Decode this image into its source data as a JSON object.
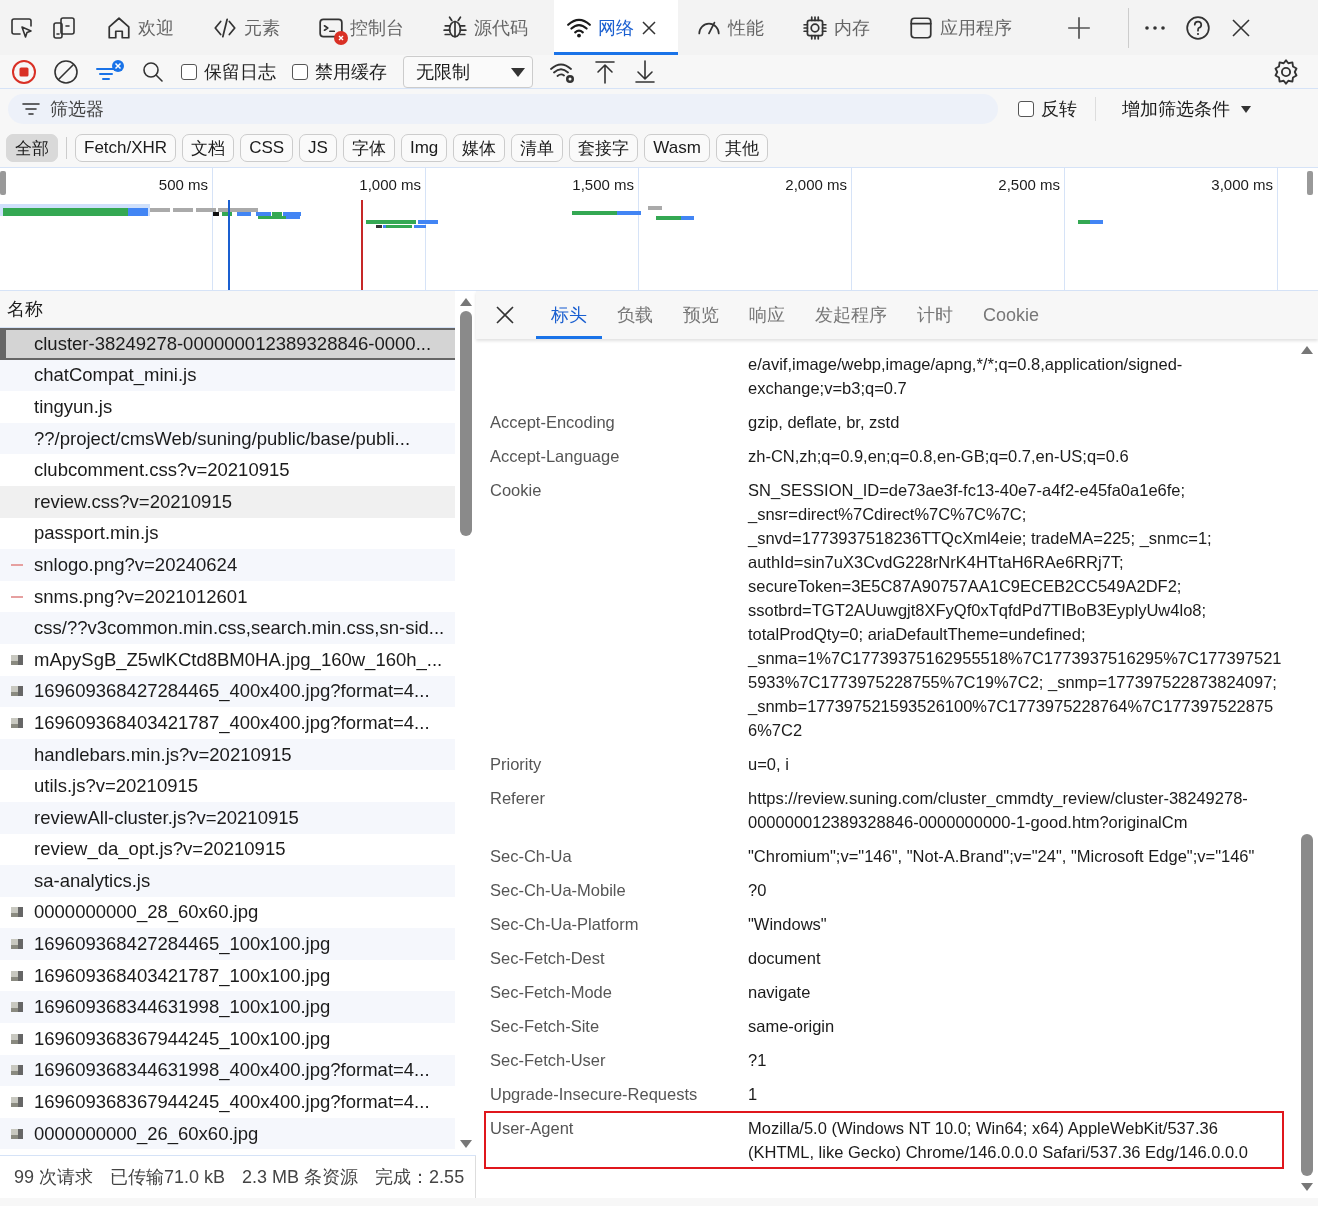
{
  "tabs": [
    {
      "label": "欢迎",
      "selected": false,
      "error_badge": false
    },
    {
      "label": "元素",
      "selected": false,
      "error_badge": false
    },
    {
      "label": "控制台",
      "selected": false,
      "error_badge": true
    },
    {
      "label": "源代码",
      "selected": false,
      "error_badge": false
    },
    {
      "label": "网络",
      "selected": true,
      "error_badge": false
    },
    {
      "label": "性能",
      "selected": false,
      "error_badge": false
    },
    {
      "label": "内存",
      "selected": false,
      "error_badge": false
    },
    {
      "label": "应用程序",
      "selected": false,
      "error_badge": false
    }
  ],
  "toolbar": {
    "recording": true,
    "filter_badge": true,
    "checkboxes": [
      {
        "label": "保留日志",
        "checked": false
      },
      {
        "label": "禁用缓存",
        "checked": false
      }
    ],
    "throttling": {
      "value": "无限制"
    }
  },
  "filter": {
    "placeholder": "筛选器",
    "invert": {
      "label": "反转",
      "checked": false
    },
    "add_filter": "增加筛选条件"
  },
  "type_filters": [
    {
      "label": "全部",
      "selected": true
    },
    {
      "label": "Fetch/XHR",
      "selected": false
    },
    {
      "label": "文档",
      "selected": false
    },
    {
      "label": "CSS",
      "selected": false
    },
    {
      "label": "JS",
      "selected": false
    },
    {
      "label": "字体",
      "selected": false
    },
    {
      "label": "Img",
      "selected": false
    },
    {
      "label": "媒体",
      "selected": false
    },
    {
      "label": "清单",
      "selected": false
    },
    {
      "label": "套接字",
      "selected": false
    },
    {
      "label": "Wasm",
      "selected": false
    },
    {
      "label": "其他",
      "selected": false
    }
  ],
  "timeline": {
    "ticks": [
      "500 ms",
      "1,000 ms",
      "1,500 ms",
      "2,000 ms",
      "2,500 ms",
      "3,000 ms"
    ]
  },
  "requests": {
    "column": "名称",
    "rows": [
      {
        "name": "cluster-38249278-000000012389328846-0000...",
        "kind": "file",
        "selected": true,
        "hovered": false
      },
      {
        "name": "chatCompat_mini.js",
        "kind": "file",
        "selected": false,
        "hovered": false
      },
      {
        "name": "tingyun.js",
        "kind": "file",
        "selected": false,
        "hovered": false
      },
      {
        "name": "??/project/cmsWeb/suning/public/base/publi...",
        "kind": "file",
        "selected": false,
        "hovered": false
      },
      {
        "name": "clubcomment.css?v=20210915",
        "kind": "file",
        "selected": false,
        "hovered": false
      },
      {
        "name": "review.css?v=20210915",
        "kind": "file",
        "selected": false,
        "hovered": true
      },
      {
        "name": "passport.min.js",
        "kind": "file",
        "selected": false,
        "hovered": false
      },
      {
        "name": "snlogo.png?v=20240624",
        "kind": "strip",
        "selected": false,
        "hovered": false
      },
      {
        "name": "snms.png?v=2021012601",
        "kind": "strip",
        "selected": false,
        "hovered": false
      },
      {
        "name": "css/??v3common.min.css,search.min.css,sn-sid...",
        "kind": "file",
        "selected": false,
        "hovered": false
      },
      {
        "name": "mApySgB_Z5wlKCtd8BM0HA.jpg_160w_160h_...",
        "kind": "image",
        "selected": false,
        "hovered": false
      },
      {
        "name": "169609368427284465_400x400.jpg?format=4...",
        "kind": "image",
        "selected": false,
        "hovered": false
      },
      {
        "name": "169609368403421787_400x400.jpg?format=4...",
        "kind": "image",
        "selected": false,
        "hovered": false
      },
      {
        "name": "handlebars.min.js?v=20210915",
        "kind": "file",
        "selected": false,
        "hovered": false
      },
      {
        "name": "utils.js?v=20210915",
        "kind": "file",
        "selected": false,
        "hovered": false
      },
      {
        "name": "reviewAll-cluster.js?v=20210915",
        "kind": "file",
        "selected": false,
        "hovered": false
      },
      {
        "name": "review_da_opt.js?v=20210915",
        "kind": "file",
        "selected": false,
        "hovered": false
      },
      {
        "name": "sa-analytics.js",
        "kind": "file",
        "selected": false,
        "hovered": false
      },
      {
        "name": "0000000000_28_60x60.jpg",
        "kind": "image",
        "selected": false,
        "hovered": false
      },
      {
        "name": "169609368427284465_100x100.jpg",
        "kind": "image",
        "selected": false,
        "hovered": false
      },
      {
        "name": "169609368403421787_100x100.jpg",
        "kind": "image",
        "selected": false,
        "hovered": false
      },
      {
        "name": "169609368344631998_100x100.jpg",
        "kind": "image",
        "selected": false,
        "hovered": false
      },
      {
        "name": "169609368367944245_100x100.jpg",
        "kind": "image",
        "selected": false,
        "hovered": false
      },
      {
        "name": "169609368344631998_400x400.jpg?format=4...",
        "kind": "image",
        "selected": false,
        "hovered": false
      },
      {
        "name": "169609368367944245_400x400.jpg?format=4...",
        "kind": "image",
        "selected": false,
        "hovered": false
      },
      {
        "name": "0000000000_26_60x60.jpg",
        "kind": "image",
        "selected": false,
        "hovered": false
      }
    ]
  },
  "status_bar": [
    "99 次请求",
    "已传输71.0 kB",
    "2.3 MB 条资源",
    "完成：2.55"
  ],
  "details": {
    "tabs": [
      {
        "label": "标头",
        "selected": true
      },
      {
        "label": "负载",
        "selected": false
      },
      {
        "label": "预览",
        "selected": false
      },
      {
        "label": "响应",
        "selected": false
      },
      {
        "label": "发起程序",
        "selected": false
      },
      {
        "label": "计时",
        "selected": false
      },
      {
        "label": "Cookie",
        "selected": false
      }
    ],
    "headers": [
      {
        "value": "e/avif,image/webp,image/apng,*/*;q=0.8,application/signed-exchange;v=b3;q=0.7",
        "highlighted": false
      },
      {
        "name": "Accept-Encoding",
        "value": "gzip, deflate, br, zstd",
        "highlighted": false
      },
      {
        "name": "Accept-Language",
        "value": "zh-CN,zh;q=0.9,en;q=0.8,en-GB;q=0.7,en-US;q=0.6",
        "highlighted": false
      },
      {
        "name": "Cookie",
        "value": "SN_SESSION_ID=de73ae3f-fc13-40e7-a4f2-e45fa0a1e6fe; _snsr=direct%7Cdirect%7C%7C%7C; _snvd=1773937518236TTQcXml4eie; tradeMA=225; _snmc=1; authId=sin7uX3CvdG228rNrK4HTtaH6RAe6RRj7T; secureToken=3E5C87A90757AA1C9ECEB2CC549A2DF2; ssotbrd=TGT2AUuwgjt8XFyQf0xTqfdPd7TIBoB3EyplyUw4lo8; totalProdQty=0; ariaDefaultTheme=undefined; _snma=1%7C17739375162955518%7C1773937516295%7C1773975215933%7C1773975228755%7C19%7C2; _snmp=177397522873824097; _snmb=177397521593526100%7C1773975228764%7C1773975228756%7C2",
        "highlighted": false
      },
      {
        "name": "Priority",
        "value": "u=0, i",
        "highlighted": false
      },
      {
        "name": "Referer",
        "value": "https://review.suning.com/cluster_cmmdty_review/cluster-38249278-000000012389328846-0000000000-1-good.htm?originalCm",
        "highlighted": false
      },
      {
        "name": "Sec-Ch-Ua",
        "value": "\"Chromium\";v=\"146\", \"Not-A.Brand\";v=\"24\", \"Microsoft Edge\";v=\"146\"",
        "highlighted": false
      },
      {
        "name": "Sec-Ch-Ua-Mobile",
        "value": "?0",
        "highlighted": false
      },
      {
        "name": "Sec-Ch-Ua-Platform",
        "value": "\"Windows\"",
        "highlighted": false
      },
      {
        "name": "Sec-Fetch-Dest",
        "value": "document",
        "highlighted": false
      },
      {
        "name": "Sec-Fetch-Mode",
        "value": "navigate",
        "highlighted": false
      },
      {
        "name": "Sec-Fetch-Site",
        "value": "same-origin",
        "highlighted": false
      },
      {
        "name": "Sec-Fetch-User",
        "value": "?1",
        "highlighted": false
      },
      {
        "name": "Upgrade-Insecure-Requests",
        "value": "1",
        "highlighted": false
      },
      {
        "name": "User-Agent",
        "value": "Mozilla/5.0 (Windows NT 10.0; Win64; x64) AppleWebKit/537.36 (KHTML, like Gecko) Chrome/146.0.0.0 Safari/537.36 Edg/146.0.0.0",
        "highlighted": true
      }
    ]
  }
}
